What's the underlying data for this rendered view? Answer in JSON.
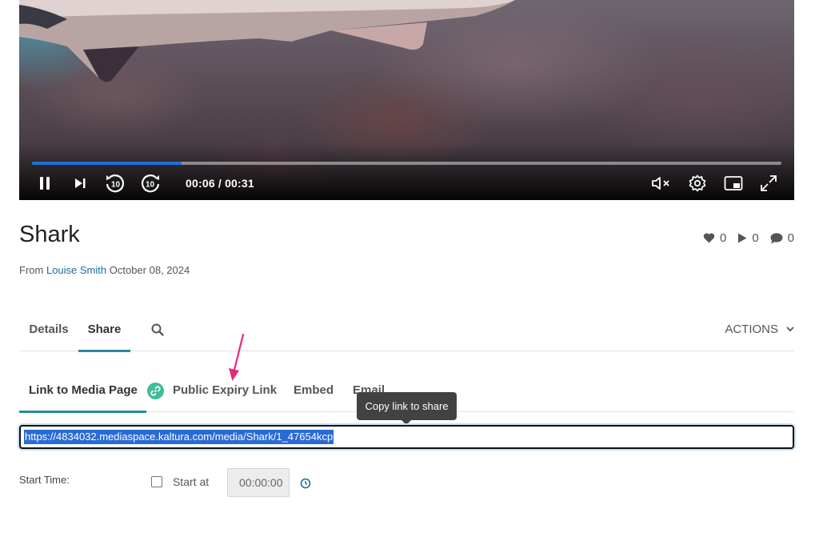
{
  "player": {
    "time_display": "00:06 / 00:31",
    "progress_fraction": 0.2,
    "accent_color": "#1f6fd8",
    "controls": [
      "pause-icon",
      "next-icon",
      "rewind-10-icon",
      "forward-10-icon",
      "mute-icon",
      "settings-gear-icon",
      "picture-in-picture-icon",
      "fullscreen-icon"
    ],
    "skip_seconds": "10"
  },
  "media": {
    "title": "Shark",
    "from_label": "From",
    "author": "Louise Smith",
    "date": "October 08, 2024",
    "likes": "0",
    "plays": "0",
    "comments": "0"
  },
  "tabs": {
    "details": "Details",
    "share": "Share",
    "actions": "ACTIONS"
  },
  "share": {
    "tabs": [
      "Link to Media Page",
      "Public Expiry Link",
      "Embed",
      "Email"
    ],
    "tooltip": "Copy link to share",
    "url": "https://4834032.mediaspace.kaltura.com/media/Shark/1_47654kcp",
    "start_time_label": "Start Time:",
    "start_at_label": "Start at",
    "start_time_value": "00:00:00",
    "accent_color": "#2b8a9a",
    "annotation_arrow_color": "#e8297a"
  }
}
